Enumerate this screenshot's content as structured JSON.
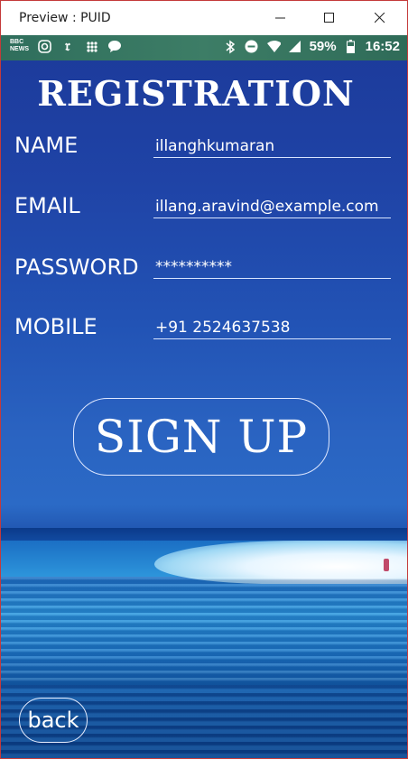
{
  "window": {
    "title": "Preview : PUID"
  },
  "statusbar": {
    "left_icons": [
      "bbc-news-icon",
      "instagram-icon",
      "nyt-icon",
      "slack-icon",
      "message-icon"
    ],
    "bbc_label": "BBC NEWS",
    "battery": "59%",
    "time": "16:52"
  },
  "form": {
    "title": "REGISTRATION",
    "fields": [
      {
        "label": "NAME",
        "value": "illanghkumaran"
      },
      {
        "label": "EMAIL",
        "value": "illang.aravind@example.com"
      },
      {
        "label": "PASSWORD",
        "value": "**********"
      },
      {
        "label": "MOBILE",
        "value": "+91 2524637538"
      }
    ],
    "signup_label": "SIGN UP",
    "back_label": "back"
  },
  "colors": {
    "accent": "#ffffff",
    "background": "#2253b5"
  }
}
